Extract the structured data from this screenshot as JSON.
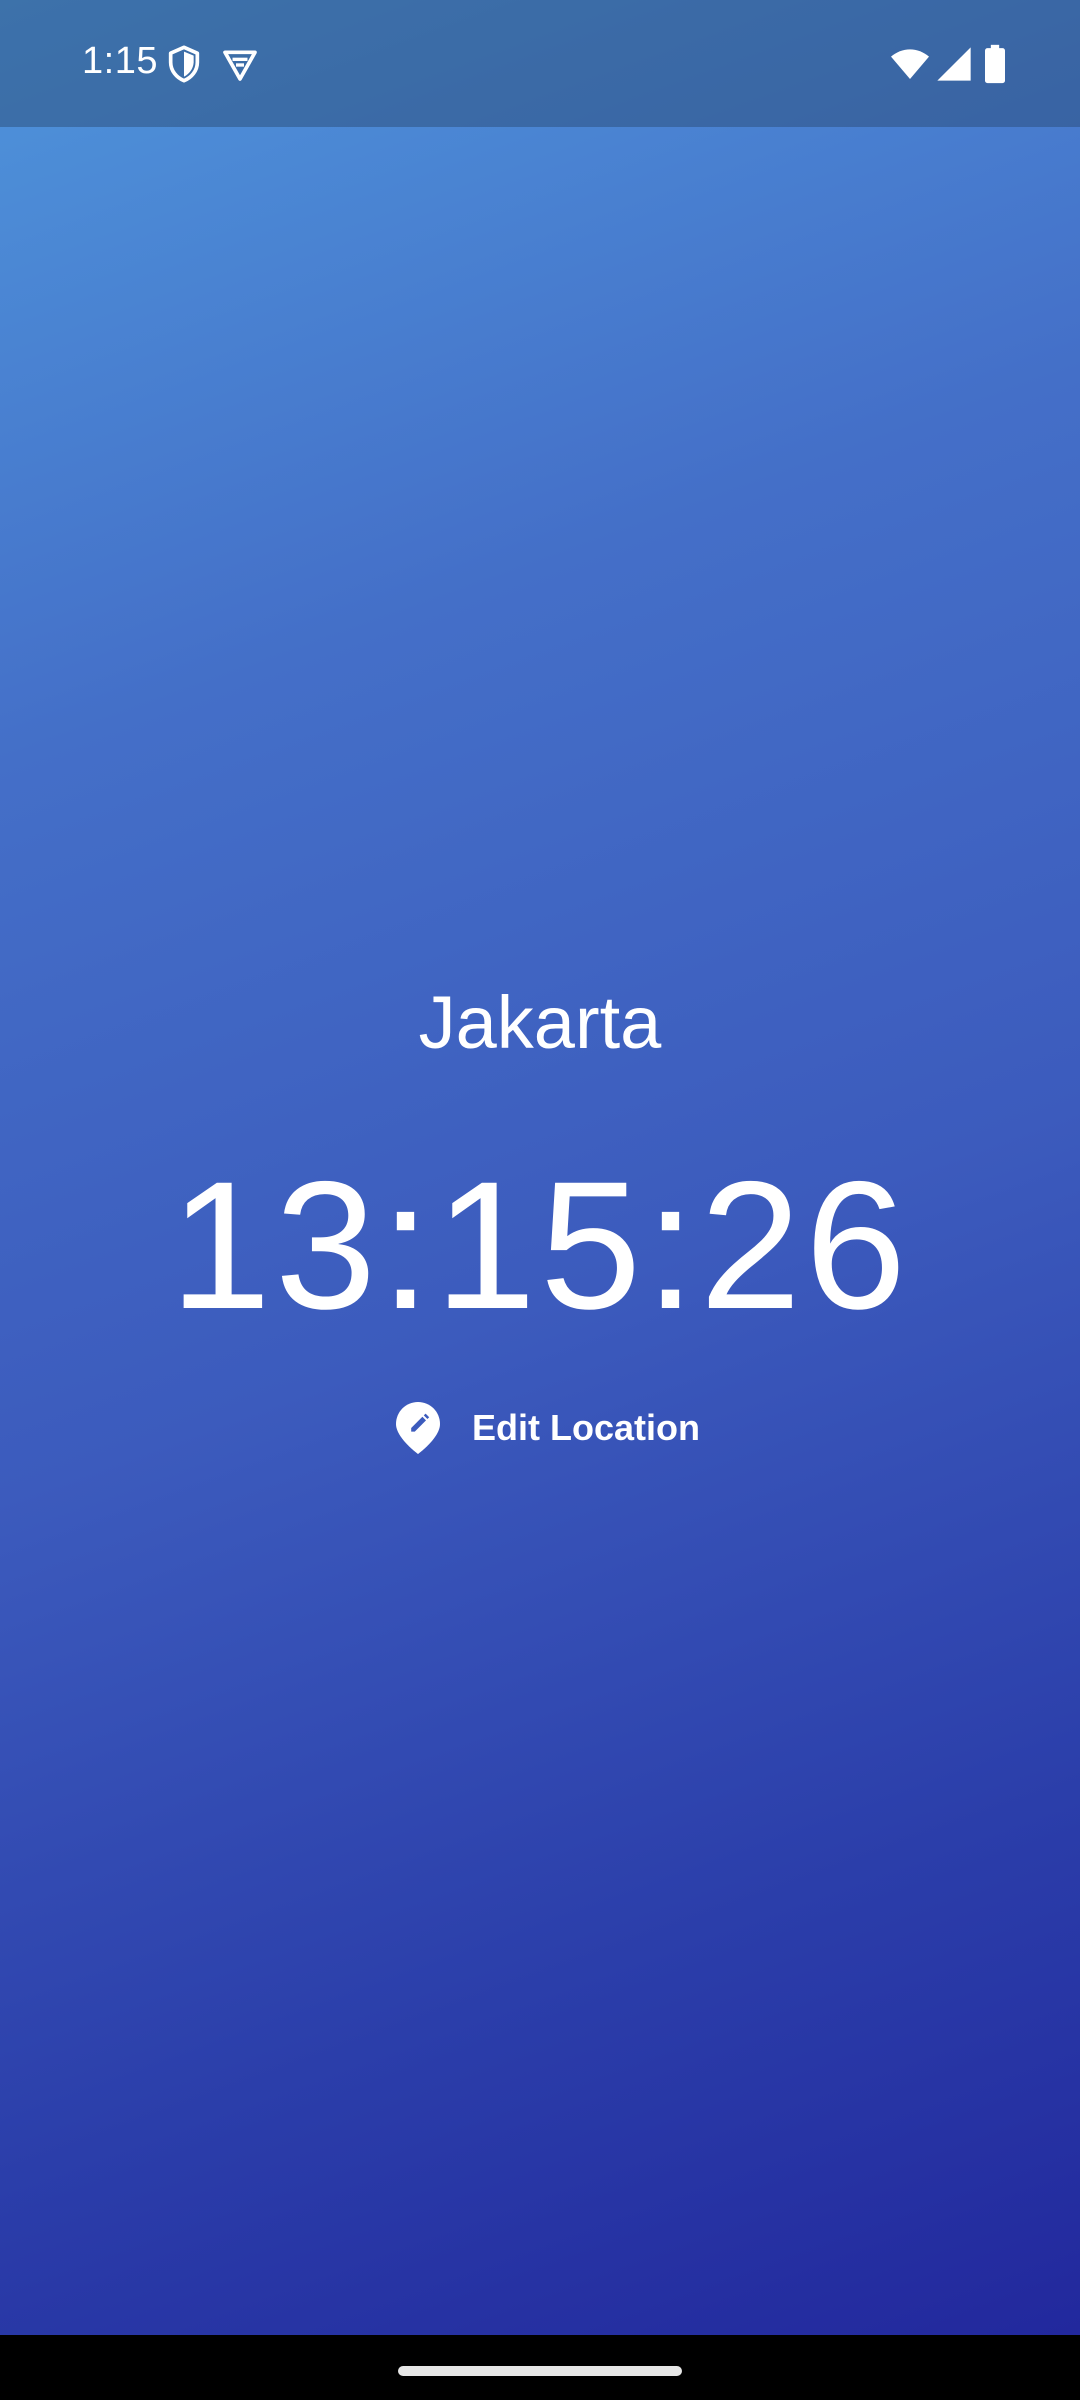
{
  "status_bar": {
    "time": "1:15",
    "left_icons": [
      "shield-icon",
      "vpn-icon"
    ],
    "right_icons": [
      "wifi-icon",
      "signal-icon",
      "battery-icon"
    ]
  },
  "main": {
    "city": "Jakarta",
    "time": "13:15:26",
    "edit_location_label": "Edit Location",
    "edit_location_icon": "edit-location-icon"
  },
  "colors": {
    "gradient_top": "#4f95db",
    "gradient_bottom": "#22289d",
    "text": "#ffffff"
  }
}
